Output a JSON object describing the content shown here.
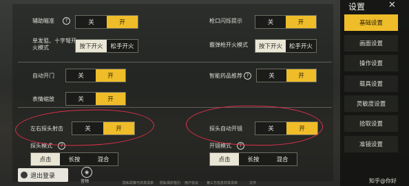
{
  "sidebar": {
    "title": "设置",
    "items": [
      {
        "label": "基础设置"
      },
      {
        "label": "画面设置"
      },
      {
        "label": "操作设置"
      },
      {
        "label": "载具设置"
      },
      {
        "label": "灵敏度设置"
      },
      {
        "label": "拾取设置"
      },
      {
        "label": "准镜设置"
      }
    ]
  },
  "settings": {
    "aim_assist": {
      "label": "辅助瞄准",
      "off": "关",
      "on": "开",
      "value": "开"
    },
    "muzzle_flash": {
      "label": "枪口闪烁提示",
      "off": "关",
      "on": "开",
      "value": "开"
    },
    "single_fire": {
      "label": "单发狙、十字弩开火模式",
      "opt1": "按下开火",
      "opt2": "松手开火",
      "value": "按下开火"
    },
    "shotgun_fire": {
      "label": "霰弹枪开火模式",
      "opt1": "按下开火",
      "opt2": "松手开火",
      "value": "按下开火"
    },
    "auto_door": {
      "label": "自动开门",
      "off": "关",
      "on": "开",
      "value": "开"
    },
    "smart_meds": {
      "label": "智能药品推荐",
      "off": "关",
      "on": "开",
      "value": "开"
    },
    "emote_zoom": {
      "label": "表情缩放",
      "off": "关",
      "on": "开",
      "value": "开"
    },
    "peek_fire": {
      "label": "左右探头射击",
      "off": "关",
      "on": "开",
      "value": "开"
    },
    "peek_scope": {
      "label": "探头自动开镜",
      "off": "关",
      "on": "开",
      "value": "开"
    },
    "peek_mode": {
      "label": "探头模式",
      "opts": [
        "点击",
        "长按",
        "混合"
      ],
      "value": "点击"
    },
    "scope_mode": {
      "label": "开镜模式",
      "opts": [
        "点击",
        "长按",
        "混合"
      ],
      "value": "点击"
    }
  },
  "footer": {
    "logout": "退出登录",
    "voice": "音频",
    "links": [
      "隐私政策与共享清单",
      "隐私保护指引",
      "用户协议",
      "第三方信息共享清单",
      "文件"
    ],
    "watermark": "知乎@你好"
  },
  "colors": {
    "accent": "#efbd2a",
    "annotation": "#e0304a"
  }
}
